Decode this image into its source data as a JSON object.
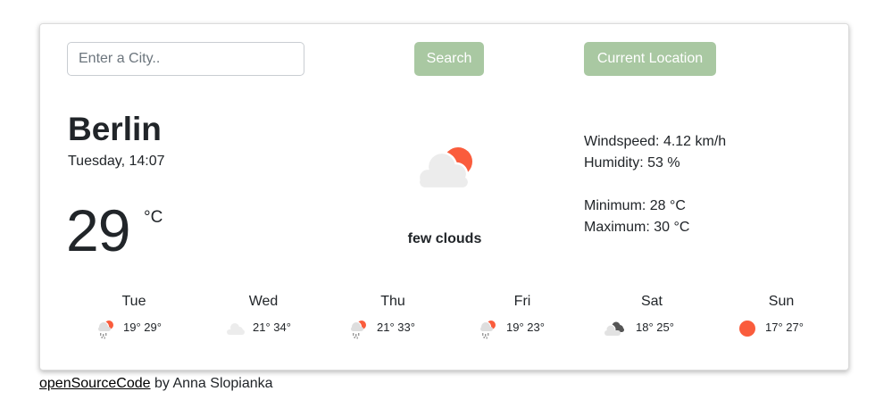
{
  "search": {
    "placeholder": "Enter a City..",
    "value": ""
  },
  "buttons": {
    "search_label": "Search",
    "location_label": "Current Location"
  },
  "current": {
    "city": "Berlin",
    "datetime": "Tuesday, 14:07",
    "temperature": "29",
    "unit": "°C",
    "description": "few clouds",
    "icon": "few-clouds-icon"
  },
  "details": {
    "wind": "Windspeed: 4.12 km/h",
    "humidity": "Humidity: 53 %",
    "minimum": "Minimum: 28 °C",
    "maximum": "Maximum: 30 °C"
  },
  "forecast": [
    {
      "day": "Tue",
      "icon": "rain-sun-icon",
      "temps": "19° 29°"
    },
    {
      "day": "Wed",
      "icon": "cloud-icon",
      "temps": "21° 34°"
    },
    {
      "day": "Thu",
      "icon": "rain-sun-icon",
      "temps": "21° 33°"
    },
    {
      "day": "Fri",
      "icon": "rain-sun-icon",
      "temps": "19° 23°"
    },
    {
      "day": "Sat",
      "icon": "broken-clouds-icon",
      "temps": "18° 25°"
    },
    {
      "day": "Sun",
      "icon": "sun-icon",
      "temps": "17° 27°"
    }
  ],
  "footer": {
    "link_text": "openSourceCode",
    "author_text": " by Anna Slopianka"
  },
  "colors": {
    "button": "#a9c8a2",
    "sun": "#fa5c3c",
    "cloud": "#ececec"
  }
}
